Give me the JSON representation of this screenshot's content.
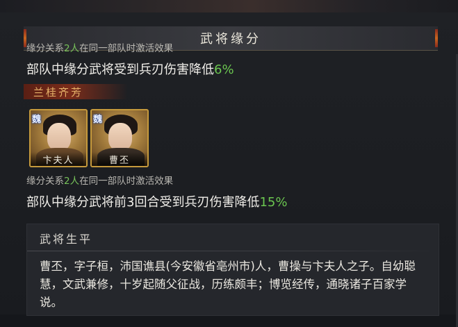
{
  "panel_title": "武将缘分",
  "bond1": {
    "condition_prefix": "缘分关系",
    "condition_count": "2人",
    "condition_suffix": "在同一部队时激活效果",
    "effect_text": "部队中缘分武将受到兵刃伤害降低",
    "effect_value": "6%"
  },
  "set_name": "兰桂齐芳",
  "generals": [
    {
      "name": "卞夫人",
      "faction": "魏"
    },
    {
      "name": "曹丕",
      "faction": "魏"
    }
  ],
  "bond2": {
    "condition_prefix": "缘分关系",
    "condition_count": "2人",
    "condition_suffix": "在同一部队时激活效果",
    "effect_text": "部队中缘分武将前3回合受到兵刃伤害降低",
    "effect_value": "15%"
  },
  "biography": {
    "title": "武将生平",
    "text": "曹丕，字子桓，沛国谯县(今安徽省亳州市)人，曹操与卞夫人之子。自幼聪慧，文武兼修，十岁起随父征战，历练颇丰；博览经传，通晓诸子百家学说。"
  },
  "colors": {
    "highlight_green": "#6bc650",
    "set_tag_gold": "#e8b46a",
    "portrait_border": "#c69a3c"
  }
}
